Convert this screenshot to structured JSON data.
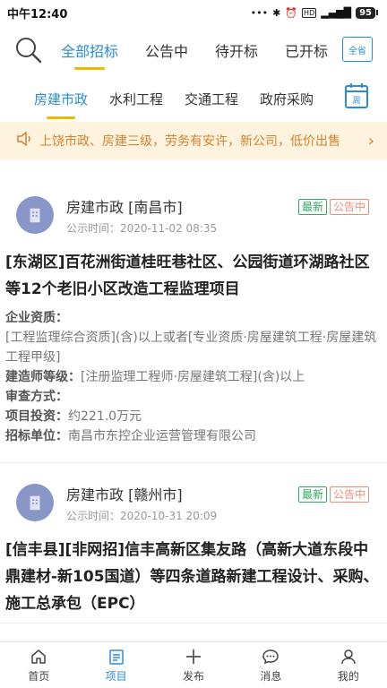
{
  "status": {
    "time": "中午12:40",
    "battery": "95",
    "icons": [
      "dots-icon",
      "bluetooth-icon",
      "alarm-icon",
      "hd-icon",
      "signal-icon"
    ]
  },
  "top_tabs": {
    "items": [
      "全部招标",
      "公告中",
      "待开标",
      "已开标"
    ],
    "active": 0,
    "province_btn": "全省"
  },
  "categories": {
    "items": [
      "房建市政",
      "水利工程",
      "交通工程",
      "政府采购"
    ],
    "active": 0,
    "calendar_label": "周"
  },
  "notice": {
    "text": "上饶市政、房建三级，劳务有安许，新公司，低价出售"
  },
  "cards": [
    {
      "category": "房建市政",
      "city": "[南昌市]",
      "time": "公示时间：2020-11-02 08:35",
      "badge_new": "最新",
      "badge_status": "公告中",
      "title": "[东湖区]百花洲街道桂旺巷社区、公园街道环湖路社区等12个老旧小区改造工程监理项目",
      "fields": {
        "qual_label": "企业资质：",
        "qual_value": "[工程监理综合资质](含)以上或者[专业资质·房屋建筑工程·房屋建筑工程甲级]",
        "arch_label": "建造师等级：",
        "arch_value": "[注册监理工程师·房屋建筑工程](含)以上",
        "review_label": "审查方式：",
        "review_value": "",
        "invest_label": "项目投资：",
        "invest_value": "约221.0万元",
        "unit_label": "招标单位：",
        "unit_value": "南昌市东控企业运营管理有限公司"
      }
    },
    {
      "category": "房建市政",
      "city": "[赣州市]",
      "time": "公示时间：2020-10-31 20:09",
      "badge_new": "最新",
      "badge_status": "公告中",
      "title": "[信丰县][非网招]信丰高新区集友路（高新大道东段中鼎建材-新105国道）等四条道路新建工程设计、采购、施工总承包（EPC）"
    }
  ],
  "bottom_nav": {
    "items": [
      "首页",
      "项目",
      "发布",
      "消息",
      "我的"
    ],
    "active": 1
  },
  "colors": {
    "accent": "#2a8bd8",
    "underline": "#f2b800",
    "notice_bg": "#fdf3df",
    "notice_text": "#d9822b",
    "new_badge": "#2eaa5c",
    "status_badge": "#f08c7a"
  }
}
